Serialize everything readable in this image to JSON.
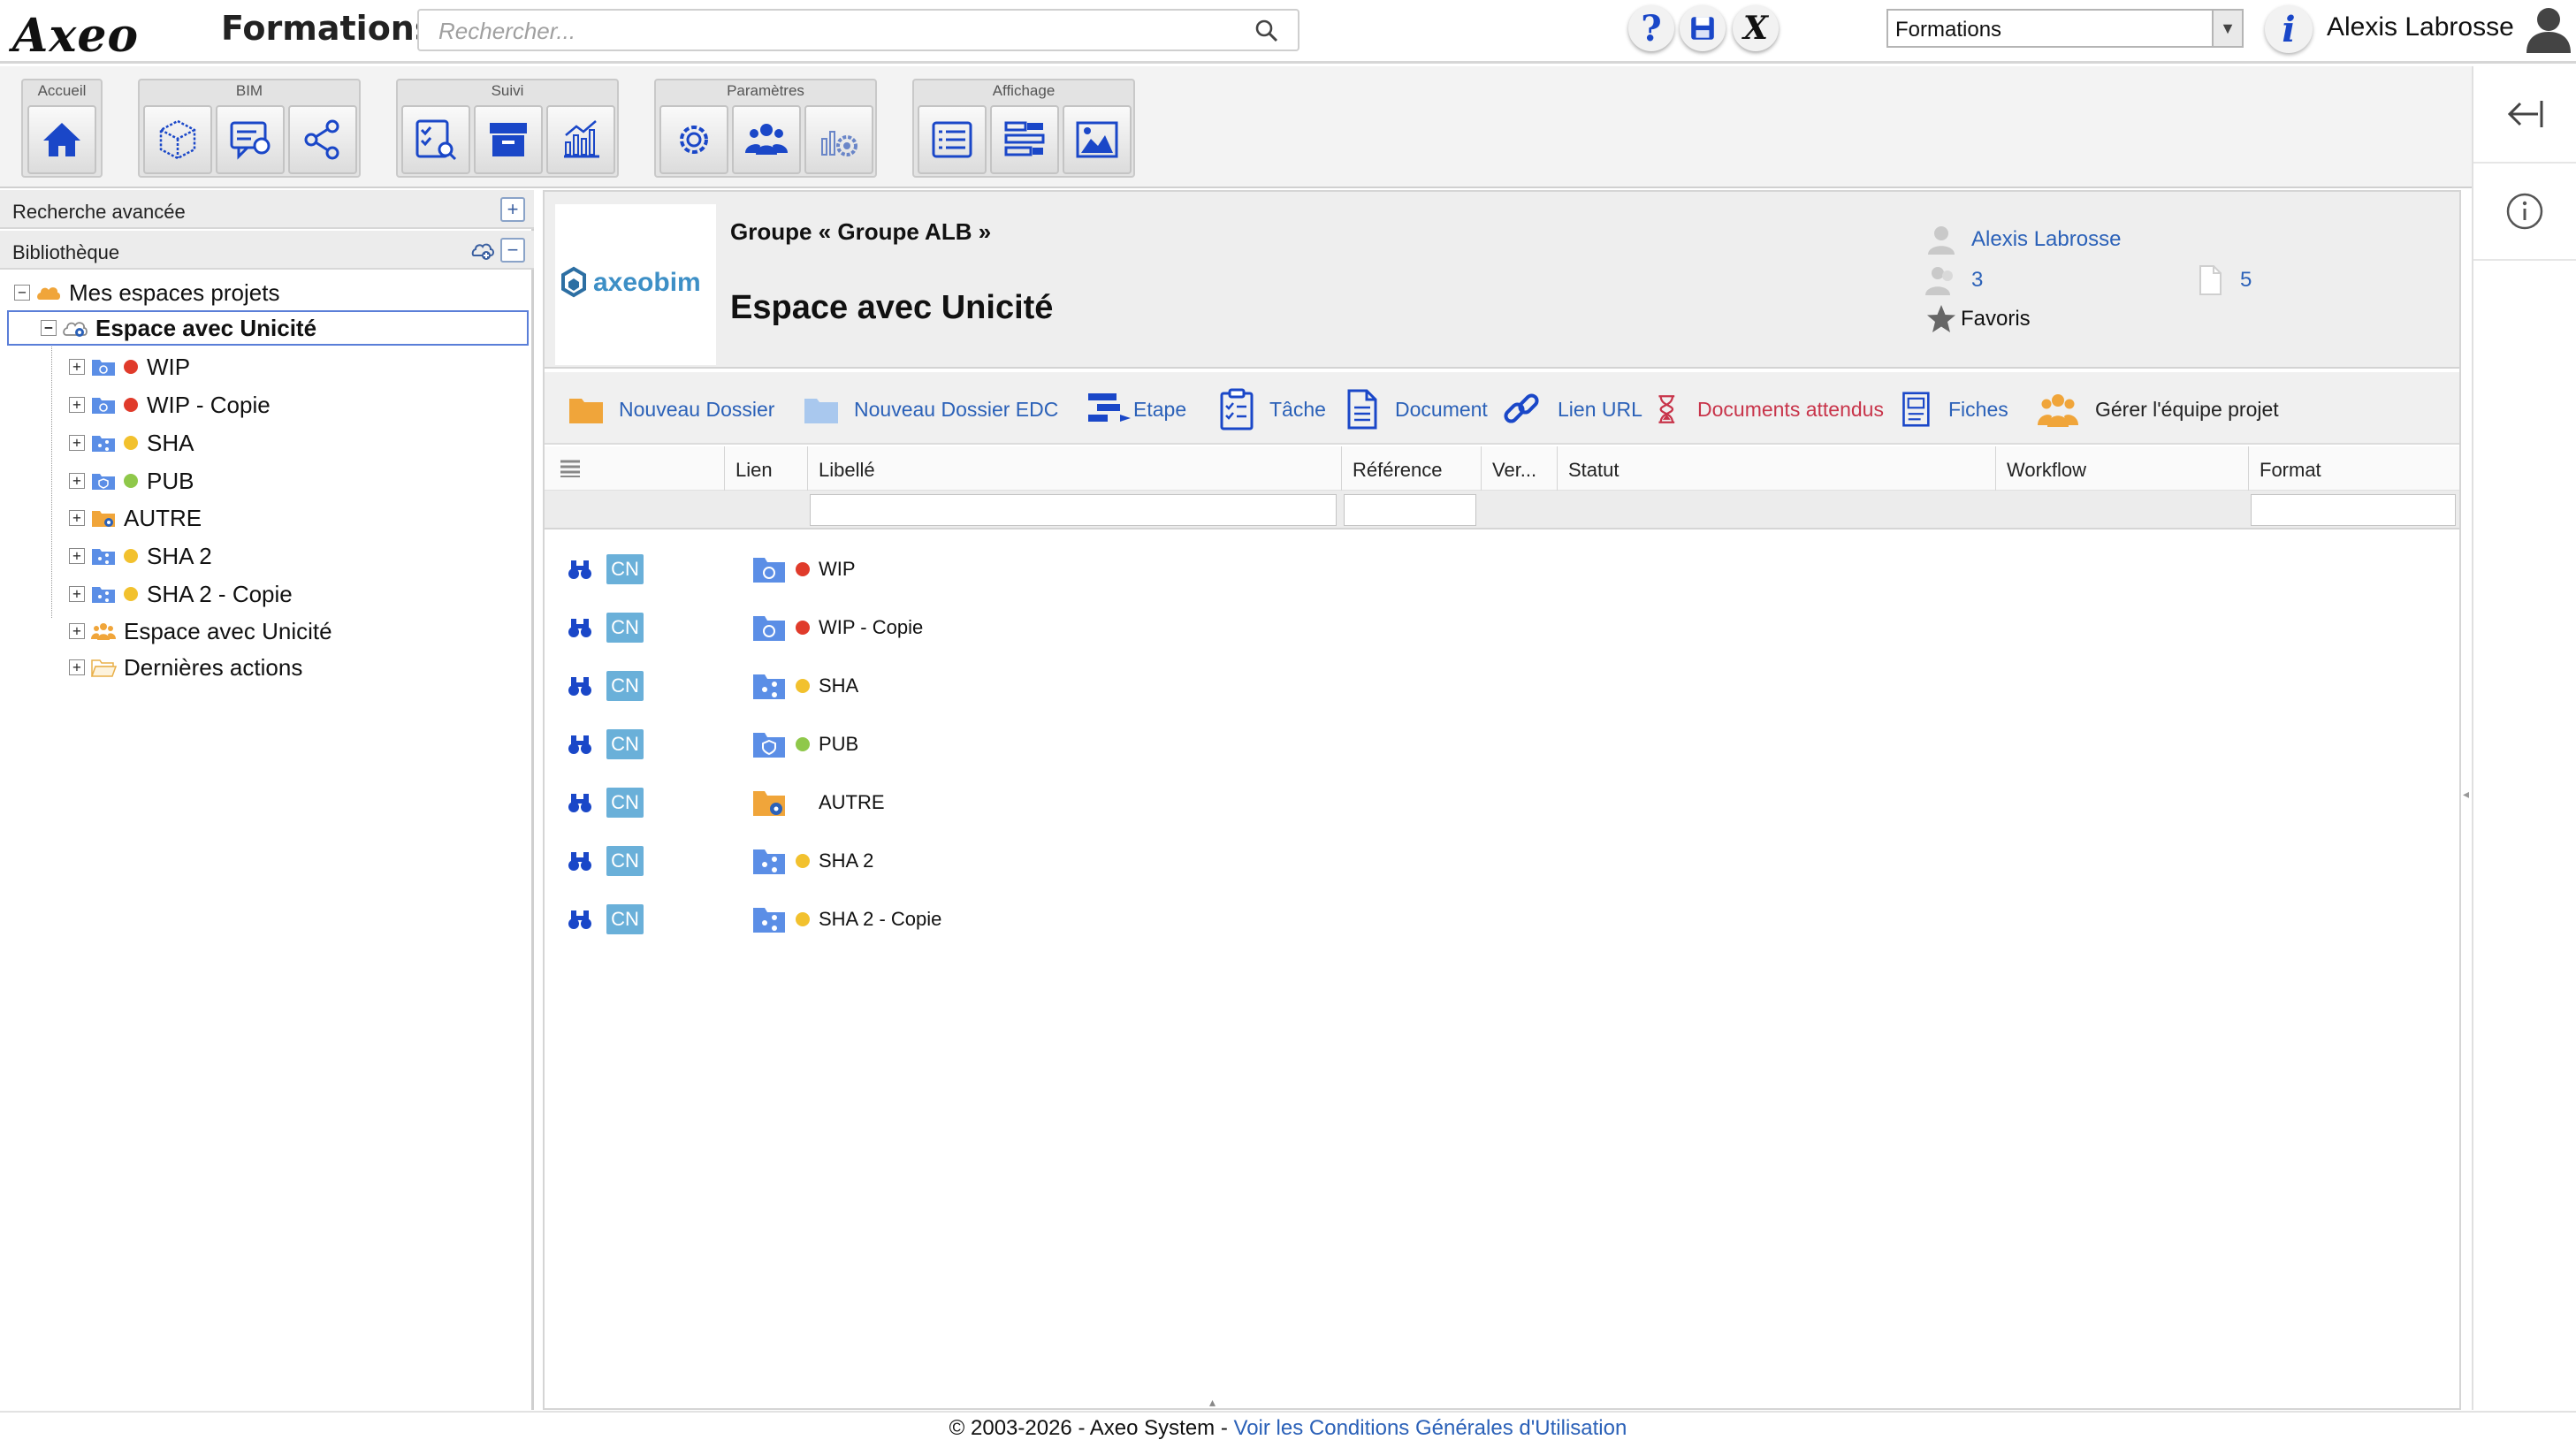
{
  "header": {
    "logo_text": "Axeo",
    "app_title": "Formations",
    "search_placeholder": "Rechercher...",
    "space_select_value": "Formations",
    "user_name": "Alexis Labrosse"
  },
  "ribbon": {
    "groups": [
      {
        "title": "Accueil"
      },
      {
        "title": "BIM"
      },
      {
        "title": "Suivi"
      },
      {
        "title": "Paramètres"
      },
      {
        "title": "Affichage"
      }
    ]
  },
  "left_panel": {
    "advanced_search": "Recherche avancée",
    "library": "Bibliothèque",
    "tree": {
      "root": "Mes espaces projets",
      "space": "Espace avec Unicité",
      "children": [
        {
          "label": "WIP",
          "status": "red"
        },
        {
          "label": "WIP - Copie",
          "status": "red"
        },
        {
          "label": "SHA",
          "status": "yellow"
        },
        {
          "label": "PUB",
          "status": "green"
        },
        {
          "label": "AUTRE",
          "status": ""
        },
        {
          "label": "SHA 2",
          "status": "yellow"
        },
        {
          "label": "SHA 2 - Copie",
          "status": "yellow"
        },
        {
          "label": "Espace avec Unicité",
          "status": ""
        },
        {
          "label": "Dernières actions",
          "status": ""
        }
      ]
    }
  },
  "space_header": {
    "logo_text": "axeobim",
    "group_title": "Groupe « Groupe ALB »",
    "space_title": "Espace avec Unicité",
    "owner": "Alexis Labrosse",
    "members_count": "3",
    "documents_count": "5",
    "favorites_label": "Favoris"
  },
  "actions": {
    "new_folder": "Nouveau Dossier",
    "new_edc_folder": "Nouveau Dossier EDC",
    "step": "Etape",
    "task": "Tâche",
    "document": "Document",
    "url_link": "Lien URL",
    "expected_docs": "Documents attendus",
    "sheets": "Fiches",
    "manage_team": "Gérer l'équipe projet"
  },
  "grid": {
    "columns": {
      "link": "Lien",
      "label": "Libellé",
      "reference": "Référence",
      "version": "Ver...",
      "status": "Statut",
      "workflow": "Workflow",
      "format": "Format"
    },
    "rows": [
      {
        "badge": "CN",
        "label": "WIP",
        "status": "red"
      },
      {
        "badge": "CN",
        "label": "WIP - Copie",
        "status": "red"
      },
      {
        "badge": "CN",
        "label": "SHA",
        "status": "yellow"
      },
      {
        "badge": "CN",
        "label": "PUB",
        "status": "green"
      },
      {
        "badge": "CN",
        "label": "AUTRE",
        "status": ""
      },
      {
        "badge": "CN",
        "label": "SHA 2",
        "status": "yellow"
      },
      {
        "badge": "CN",
        "label": "SHA 2 - Copie",
        "status": "yellow"
      }
    ]
  },
  "footer": {
    "copyright": "© 2003-2026 - Axeo System  -",
    "terms_link": "Voir les Conditions Générales d'Utilisation"
  },
  "colors": {
    "accent_blue": "#2b61b8",
    "icon_blue": "#1a47c8",
    "status_red": "#e03b2b",
    "status_yellow": "#f2c12e",
    "status_green": "#8fc84a",
    "alert_red": "#c8344a"
  }
}
